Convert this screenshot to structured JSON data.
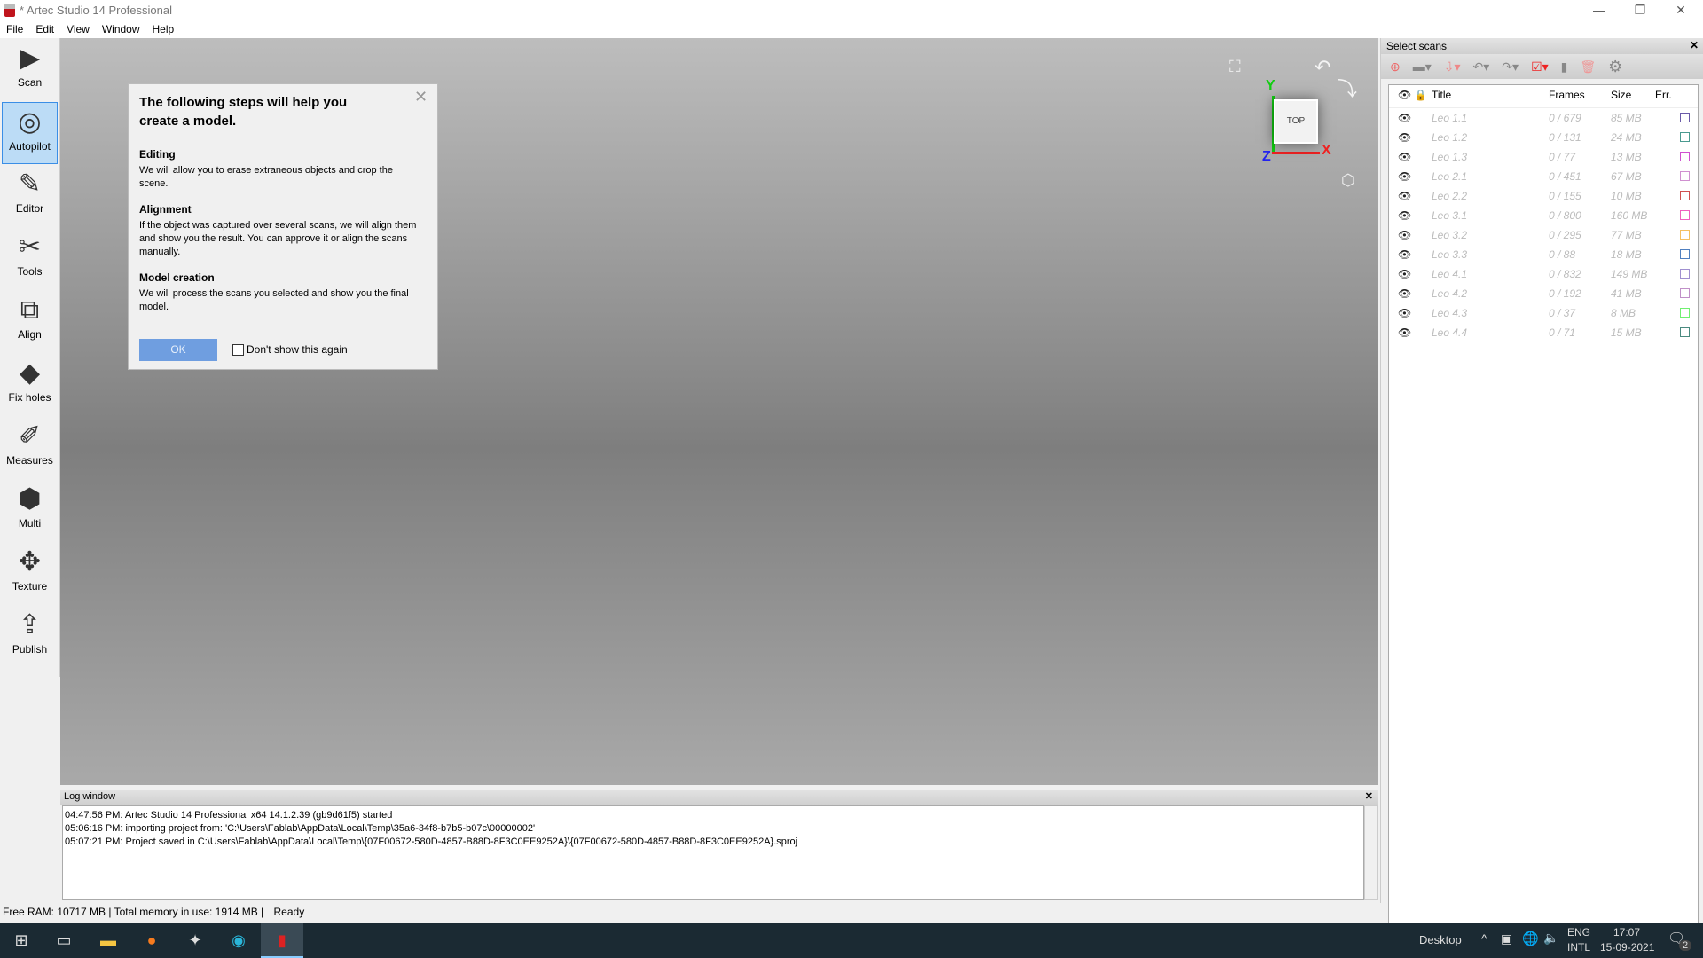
{
  "window": {
    "title": "* Artec Studio 14 Professional",
    "minimize": "—",
    "restore": "❐",
    "close": "✕"
  },
  "menu": [
    "File",
    "Edit",
    "View",
    "Window",
    "Help"
  ],
  "sidebar": {
    "items": [
      {
        "label": "Scan"
      },
      {
        "label": "Autopilot",
        "selected": true
      },
      {
        "label": "Editor"
      },
      {
        "label": "Tools"
      },
      {
        "label": "Align"
      },
      {
        "label": "Fix holes"
      },
      {
        "label": "Measures"
      },
      {
        "label": "Multi"
      },
      {
        "label": "Texture"
      },
      {
        "label": "Publish"
      }
    ]
  },
  "dialog": {
    "title": "The following steps will help you create a model.",
    "sections": [
      {
        "heading": "Editing",
        "text": "We will allow you to erase extraneous objects and crop the scene."
      },
      {
        "heading": "Alignment",
        "text": "If the object was captured over several scans, we will align them and show you the result. You can approve it or align the scans manually."
      },
      {
        "heading": "Model creation",
        "text": "We will process the scans you selected and show you the final model."
      }
    ],
    "ok": "OK",
    "dont_show": "Don't show this again",
    "dont_show_checked": false
  },
  "viewport": {
    "gizmo": {
      "face": "TOP",
      "x": "X",
      "y": "Y",
      "z": "Z"
    }
  },
  "scans_panel": {
    "title": "Select scans",
    "close": "✕",
    "columns": [
      "Title",
      "Frames",
      "Size",
      "Err."
    ],
    "rows": [
      {
        "title": "Leo 1.1",
        "frames": "0 / 679",
        "size": "85 MB",
        "color": "#6a5aa8"
      },
      {
        "title": "Leo 1.2",
        "frames": "0 / 131",
        "size": "24 MB",
        "color": "#4a9a90"
      },
      {
        "title": "Leo 1.3",
        "frames": "0 / 77",
        "size": "13 MB",
        "color": "#d050d0"
      },
      {
        "title": "Leo 2.1",
        "frames": "0 / 451",
        "size": "67 MB",
        "color": "#d090d0"
      },
      {
        "title": "Leo 2.2",
        "frames": "0 / 155",
        "size": "10 MB",
        "color": "#d05050"
      },
      {
        "title": "Leo 3.1",
        "frames": "0 / 800",
        "size": "160 MB",
        "color": "#f060c0"
      },
      {
        "title": "Leo 3.2",
        "frames": "0 / 295",
        "size": "77 MB",
        "color": "#f5c060"
      },
      {
        "title": "Leo 3.3",
        "frames": "0 / 88",
        "size": "18 MB",
        "color": "#5080c0"
      },
      {
        "title": "Leo 4.1",
        "frames": "0 / 832",
        "size": "149 MB",
        "color": "#a090d0"
      },
      {
        "title": "Leo 4.2",
        "frames": "0 / 192",
        "size": "41 MB",
        "color": "#c090c8"
      },
      {
        "title": "Leo 4.3",
        "frames": "0 / 37",
        "size": "8 MB",
        "color": "#70f070"
      },
      {
        "title": "Leo 4.4",
        "frames": "0 / 71",
        "size": "15 MB",
        "color": "#4a8a80"
      }
    ]
  },
  "log": {
    "title": "Log window",
    "close": "✕",
    "lines": [
      "04:47:56 PM: Artec Studio 14 Professional x64 14.1.2.39 (gb9d61f5) started",
      "05:06:16 PM: importing project from: 'C:\\Users\\Fablab\\AppData\\Local\\Temp\\35a6-34f8-b7b5-b07c\\00000002'",
      "05:07:21 PM: Project saved in C:\\Users\\Fablab\\AppData\\Local\\Temp\\{07F00672-580D-4857-B88D-8F3C0EE9252A}\\{07F00672-580D-4857-B88D-8F3C0EE9252A}.sproj"
    ]
  },
  "status": {
    "free_ram": "Free RAM: 10717 MB",
    "total_mem": "Total memory in use: 1914 MB",
    "state": "Ready"
  },
  "taskbar": {
    "desktop": "Desktop",
    "lang1": "ENG",
    "lang2": "INTL",
    "time": "17:07",
    "date": "15-09-2021",
    "notifications": "2"
  }
}
